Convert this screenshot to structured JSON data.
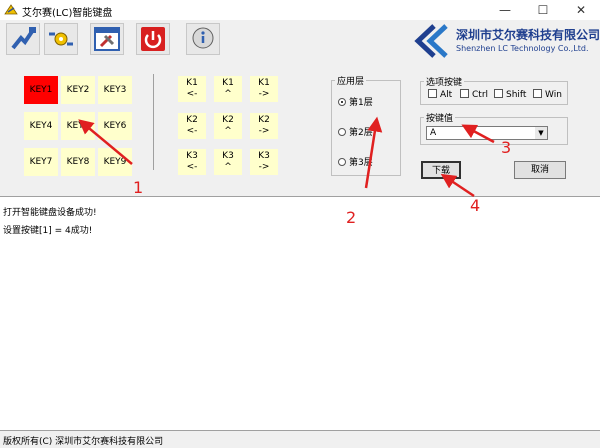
{
  "window": {
    "title": "艾尔赛(LC)智能键盘",
    "controls": [
      "—",
      "☐",
      "✕"
    ]
  },
  "toolbar": {
    "buttons": [
      {
        "name": "connect",
        "icon": "usb-plug-icon"
      },
      {
        "name": "settings",
        "icon": "gear-arrows-icon"
      },
      {
        "name": "tools",
        "icon": "tools-window-icon"
      },
      {
        "name": "power",
        "icon": "power-icon"
      },
      {
        "name": "about",
        "icon": "info-bubble-icon"
      }
    ]
  },
  "logo": {
    "cn": "深圳市艾尔赛科技有限公司",
    "en": "Shenzhen LC Technology Co.,Ltd."
  },
  "keys": [
    {
      "label": "KEY1",
      "active": true
    },
    {
      "label": "KEY2",
      "active": false
    },
    {
      "label": "KEY3",
      "active": false
    },
    {
      "label": "KEY4",
      "active": false
    },
    {
      "label": "KEY5",
      "active": false
    },
    {
      "label": "KEY6",
      "active": false
    },
    {
      "label": "KEY7",
      "active": false
    },
    {
      "label": "KEY8",
      "active": false
    },
    {
      "label": "KEY9",
      "active": false
    }
  ],
  "knobs": [
    {
      "top": "K1",
      "bottom": "<-"
    },
    {
      "top": "K1",
      "bottom": "^"
    },
    {
      "top": "K1",
      "bottom": "->"
    },
    {
      "top": "K2",
      "bottom": "<-"
    },
    {
      "top": "K2",
      "bottom": "^"
    },
    {
      "top": "K2",
      "bottom": "->"
    },
    {
      "top": "K3",
      "bottom": "<-"
    },
    {
      "top": "K3",
      "bottom": "^"
    },
    {
      "top": "K3",
      "bottom": "->"
    }
  ],
  "layer_group": {
    "title": "应用层",
    "options": [
      {
        "label": "第1层",
        "selected": true
      },
      {
        "label": "第2层",
        "selected": false
      },
      {
        "label": "第3层",
        "selected": false
      }
    ]
  },
  "modifier_group": {
    "title": "选项按键",
    "options": [
      {
        "label": "Alt",
        "checked": false
      },
      {
        "label": "Ctrl",
        "checked": false
      },
      {
        "label": "Shift",
        "checked": false
      },
      {
        "label": "Win",
        "checked": false
      }
    ]
  },
  "key_value_group": {
    "title": "按键值",
    "selected": "A"
  },
  "buttons": {
    "download": "下载",
    "cancel": "取消"
  },
  "log": [
    "打开智能键盘设备成功!",
    "设置按键[1] = 4成功!"
  ],
  "status": "版权所有(C) 深圳市艾尔赛科技有限公司",
  "annotations": [
    "1",
    "2",
    "3",
    "4"
  ],
  "colors": {
    "accent_red": "#ff0000",
    "key_bg": "#ffffcc",
    "annotation": "#e02020"
  }
}
